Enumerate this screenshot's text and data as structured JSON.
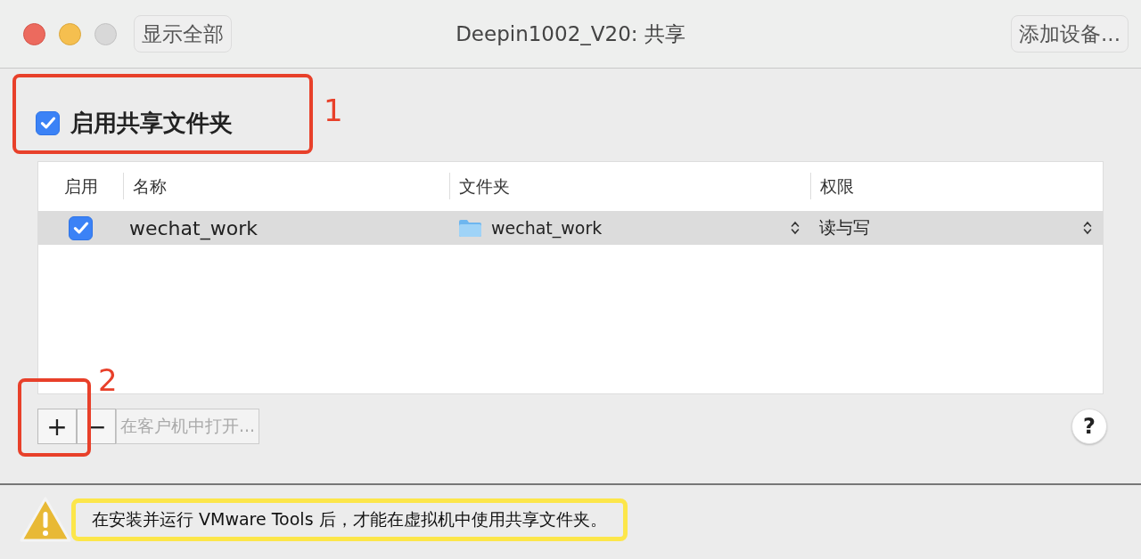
{
  "window": {
    "title": "Deepin1002_V20: 共享"
  },
  "toolbar": {
    "show_all": "显示全部",
    "add_device": "添加设备..."
  },
  "enable_sharing": {
    "label": "启用共享文件夹",
    "checked": true
  },
  "table": {
    "columns": [
      "启用",
      "名称",
      "文件夹",
      "权限"
    ],
    "rows": [
      {
        "enabled": true,
        "selected": true,
        "name": "wechat_work",
        "folder": "wechat_work",
        "permission": "读与写"
      }
    ]
  },
  "buttons": {
    "add": "+",
    "remove": "−",
    "open_in_guest": {
      "label": "在客户机中打开...",
      "disabled": true
    },
    "help": "?"
  },
  "annotations": [
    {
      "label": "1"
    },
    {
      "label": "2"
    }
  ],
  "message": {
    "text": "在安装并运行 VMware Tools 后，才能在虚拟机中使用共享文件夹。",
    "highlighted": true
  }
}
